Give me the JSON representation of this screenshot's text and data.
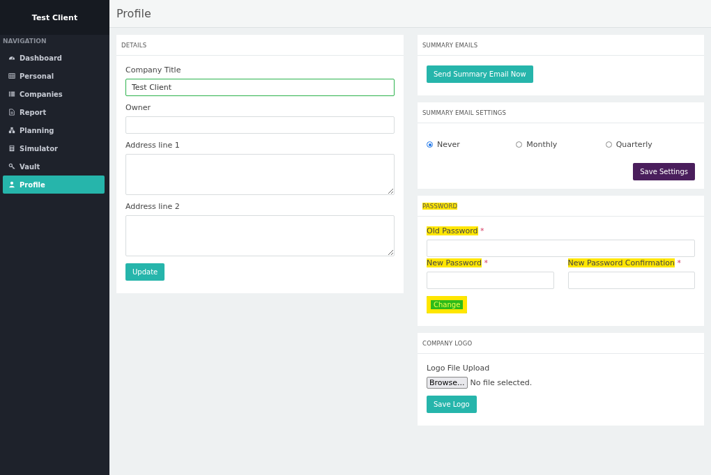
{
  "sidebar": {
    "brand": "Test Client",
    "section": "NAVIGATION",
    "items": [
      {
        "label": "Dashboard",
        "selected": false
      },
      {
        "label": "Personal",
        "selected": false
      },
      {
        "label": "Companies",
        "selected": false
      },
      {
        "label": "Report",
        "selected": false
      },
      {
        "label": "Planning",
        "selected": false
      },
      {
        "label": "Simulator",
        "selected": false
      },
      {
        "label": "Vault",
        "selected": false
      },
      {
        "label": "Profile",
        "selected": true
      }
    ]
  },
  "page": {
    "title": "Profile"
  },
  "details": {
    "heading": "DETAILS",
    "fields": [
      {
        "label": "Company Title",
        "kind": "input",
        "value": "Test Client",
        "focused": true
      },
      {
        "label": "Owner",
        "kind": "input",
        "focused": false
      },
      {
        "label": "Address line 1",
        "kind": "textarea",
        "focused": false
      },
      {
        "label": "Address line 2",
        "kind": "textarea",
        "focused": false
      }
    ],
    "button": "Update"
  },
  "summary_emails": {
    "heading": "SUMMARY EMAILS",
    "button": "Send Summary Email Now"
  },
  "summary_settings": {
    "heading": "SUMMARY EMAIL SETTINGS",
    "options": [
      {
        "label": "Never",
        "selected": true
      },
      {
        "label": "Monthly",
        "selected": false
      },
      {
        "label": "Quarterly",
        "selected": false
      }
    ],
    "button": "Save Settings"
  },
  "password": {
    "heading": "PASSWORD",
    "heading_highlighted": true,
    "fields": [
      {
        "label": "Old Password",
        "required": "*",
        "highlighted": true
      },
      {
        "label": "New Password",
        "required": "*",
        "highlighted": true
      },
      {
        "label": "New Password Confirmation",
        "required": "*",
        "highlighted": true
      }
    ],
    "button": "Change",
    "button_highlighted": true
  },
  "company_logo": {
    "heading": "COMPANY LOGO",
    "label": "Logo File Upload",
    "browse": "Browse...",
    "file_status": "No file selected.",
    "button": "Save Logo"
  }
}
